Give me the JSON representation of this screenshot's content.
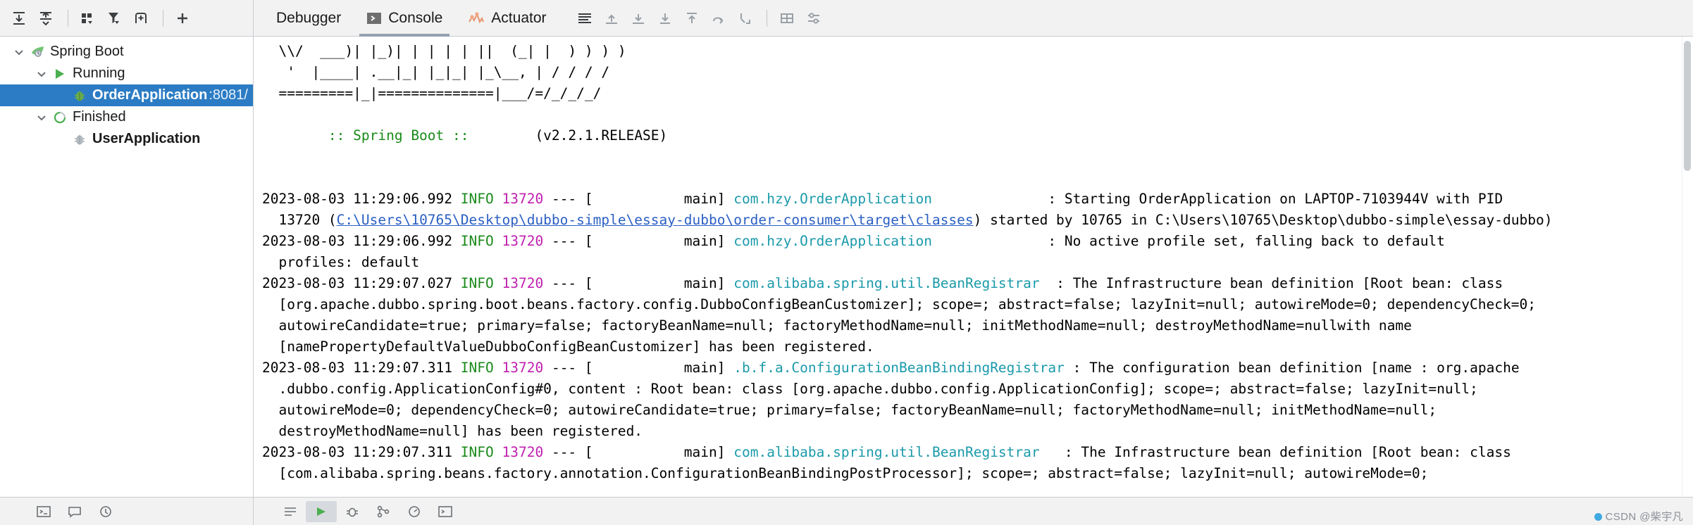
{
  "toolbar_left": {
    "icons": [
      {
        "name": "scroll-to-end-icon",
        "glyph": "expand-v"
      },
      {
        "name": "collapse-icon",
        "glyph": "collapse-v"
      },
      {
        "name": "group-icon",
        "glyph": "group"
      },
      {
        "name": "filter-icon",
        "glyph": "filter"
      },
      {
        "name": "add-frame-icon",
        "glyph": "addframe"
      },
      {
        "name": "add-icon",
        "glyph": "plus"
      }
    ]
  },
  "tree": {
    "items": [
      {
        "label": "Spring Boot",
        "suffix": "",
        "icon": "spring-leaf-icon",
        "indent": 0,
        "chevron": "down",
        "selected": false,
        "bold": false
      },
      {
        "label": "Running",
        "suffix": "",
        "icon": "run-triangle-icon",
        "indent": 1,
        "chevron": "down",
        "selected": false,
        "bold": false
      },
      {
        "label": "OrderApplication",
        "suffix": ":8081/",
        "icon": "spring-bean-icon",
        "indent": 2,
        "chevron": "none",
        "selected": true,
        "bold": true
      },
      {
        "label": "Finished",
        "suffix": "",
        "icon": "finished-icon",
        "indent": 1,
        "chevron": "down",
        "selected": false,
        "bold": false
      },
      {
        "label": "UserApplication",
        "suffix": "",
        "icon": "spring-bean-gray-icon",
        "indent": 2,
        "chevron": "none",
        "selected": false,
        "bold": true
      }
    ]
  },
  "tabs": [
    {
      "label": "Debugger",
      "icon": "none",
      "active": false
    },
    {
      "label": "Console",
      "icon": "console-icon",
      "active": true
    },
    {
      "label": "Actuator",
      "icon": "actuator-icon",
      "active": false
    }
  ],
  "tab_toolbar": {
    "icons": [
      {
        "name": "soft-wrap-icon",
        "glyph": "lines"
      },
      {
        "name": "step-up-icon",
        "glyph": "arrow-up-line"
      },
      {
        "name": "step-down-icon",
        "glyph": "arrow-down-line"
      },
      {
        "name": "download-icon",
        "glyph": "arrow-down-bar"
      },
      {
        "name": "upload-icon",
        "glyph": "arrow-up-bar"
      },
      {
        "name": "step-over-icon",
        "glyph": "curved-arrow"
      },
      {
        "name": "step-out-icon",
        "glyph": "curved-arrow-alt"
      },
      {
        "name": "print-icon",
        "glyph": "grid"
      },
      {
        "name": "settings-icon",
        "glyph": "sliders"
      }
    ]
  },
  "console": {
    "banner": [
      "  \\\\/  ___)| |_)| | | | | ||  (_| |  ) ) ) )",
      "   '  |____| .__|_| |_|_| |_\\__, | / / / /",
      "  =========|_|==============|___/=/_/_/_/",
      "  :: Spring Boot ::        (v2.2.1.RELEASE)"
    ],
    "spring_boot_label": ":: Spring Boot ::",
    "spring_boot_version": "(v2.2.1.RELEASE)",
    "log": [
      {
        "ts": "2023-08-03 11:29:06.992",
        "level": "INFO",
        "pid": "13720",
        "sep": "--- [",
        "thread": "           main]",
        "logger": "com.hzy.OrderApplication",
        "logger_pad": "              ",
        "colon": ": ",
        "msg": "Starting OrderApplication on LAPTOP-7103944V with PID",
        "cont_prefix": "  13720 (",
        "link": "C:\\Users\\10765\\Desktop\\dubbo-simple\\essay-dubbo\\order-consumer\\target\\classes",
        "cont_suffix": ") started by 10765 in C:\\Users\\10765\\Desktop\\dubbo-simple\\essay-dubbo)"
      },
      {
        "ts": "2023-08-03 11:29:06.992",
        "level": "INFO",
        "pid": "13720",
        "sep": "--- [",
        "thread": "           main]",
        "logger": "com.hzy.OrderApplication",
        "logger_pad": "              ",
        "colon": ": ",
        "msg": "No active profile set, falling back to default",
        "cont": "  profiles: default"
      },
      {
        "ts": "2023-08-03 11:29:07.027",
        "level": "INFO",
        "pid": "13720",
        "sep": "--- [",
        "thread": "           main]",
        "logger": "com.alibaba.spring.util.BeanRegistrar",
        "logger_pad": "  ",
        "colon": ": ",
        "msg": "The Infrastructure bean definition [Root bean: class",
        "cont_lines": [
          "  [org.apache.dubbo.spring.boot.beans.factory.config.DubboConfigBeanCustomizer]; scope=; abstract=false; lazyInit=null; autowireMode=0; dependencyCheck=0;",
          "  autowireCandidate=true; primary=false; factoryBeanName=null; factoryMethodName=null; initMethodName=null; destroyMethodName=nullwith name",
          "  [namePropertyDefaultValueDubboConfigBeanCustomizer] has been registered."
        ]
      },
      {
        "ts": "2023-08-03 11:29:07.311",
        "level": "INFO",
        "pid": "13720",
        "sep": "--- [",
        "thread": "           main]",
        "logger": ".b.f.a.ConfigurationBeanBindingRegistrar",
        "logger_pad": " ",
        "colon": ": ",
        "msg": "The configuration bean definition [name : org.apache",
        "cont_lines": [
          "  .dubbo.config.ApplicationConfig#0, content : Root bean: class [org.apache.dubbo.config.ApplicationConfig]; scope=; abstract=false; lazyInit=null;",
          "  autowireMode=0; dependencyCheck=0; autowireCandidate=true; primary=false; factoryBeanName=null; factoryMethodName=null; initMethodName=null;",
          "  destroyMethodName=null] has been registered."
        ]
      },
      {
        "ts": "2023-08-03 11:29:07.311",
        "level": "INFO",
        "pid": "13720",
        "sep": "--- [",
        "thread": "           main]",
        "logger": "com.alibaba.spring.util.BeanRegistrar",
        "logger_pad": "   ",
        "colon": ": ",
        "msg": "The Infrastructure bean definition [Root bean: class",
        "cont_lines": [
          "  [com.alibaba.spring.beans.factory.annotation.ConfigurationBeanBindingPostProcessor]; scope=; abstract=false; lazyInit=null; autowireMode=0;"
        ]
      }
    ]
  },
  "watermark": "CSDN @柴宇凡",
  "colors": {
    "selection": "#2b7cc4",
    "info_green": "#1a8a1a",
    "pid_magenta": "#c020b0",
    "logger_cyan": "#1b9aaa",
    "link_blue": "#2b5fc4",
    "toolbar_bg": "#f2f2f2"
  }
}
